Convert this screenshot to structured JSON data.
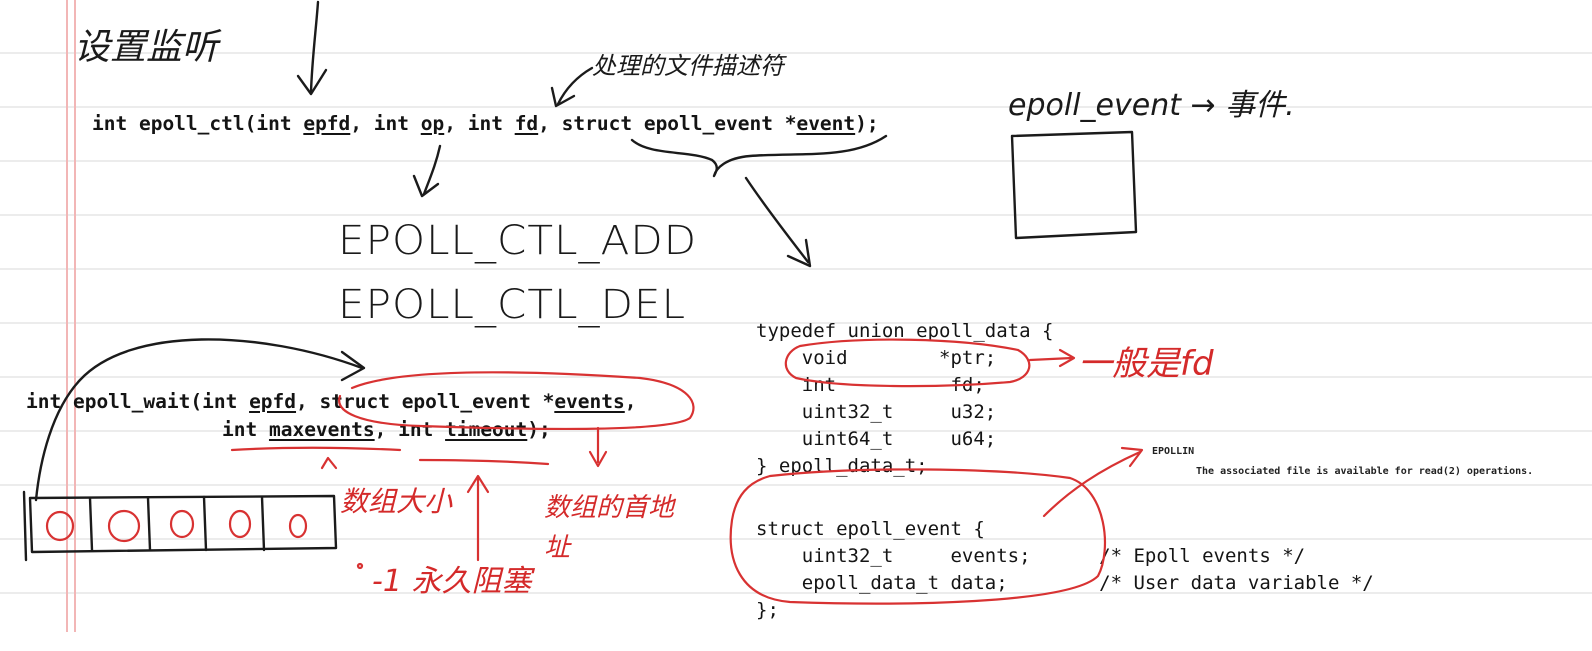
{
  "code": {
    "ctl": {
      "prefix": "int epoll_ctl(int ",
      "epfd": "epfd",
      "sep1": ", int ",
      "op": "op",
      "sep2": ", int ",
      "fd": "fd",
      "sep3": ", struct epoll_event *",
      "event": "event",
      "suffix": ");"
    },
    "wait": {
      "prefix": "int epoll_wait(int ",
      "epfd": "epfd",
      "sep1": ", struct epoll_event *",
      "events": "events",
      "comma": ",",
      "indent": "int ",
      "maxevents": "maxevents",
      "sep2": ", int ",
      "timeout": "timeout",
      "suffix": ");"
    },
    "union_lines": [
      "typedef union epoll_data {",
      "    void        *ptr;",
      "    int          fd;",
      "    uint32_t     u32;",
      "    uint64_t     u64;",
      "} epoll_data_t;"
    ],
    "struct_lines": [
      "struct epoll_event {",
      "    uint32_t     events;      /* Epoll events */",
      "    epoll_data_t data;        /* User data variable */",
      "};"
    ]
  },
  "man": {
    "term": "EPOLLIN",
    "desc": "The associated file is available for read(2) operations."
  },
  "notes": {
    "set_listen": "设置监听",
    "fd_note": "处理的文件描述符",
    "epoll_event_note": "epoll_event → 事件.",
    "op_add": "EPOLL_CTL_ADD",
    "op_del": "EPOLL_CTL_DEL",
    "usually_fd": "一般是fd",
    "array_size": "数组大小",
    "array_addr": "数组的首地址",
    "minus_one": "-1 永久阻塞"
  }
}
